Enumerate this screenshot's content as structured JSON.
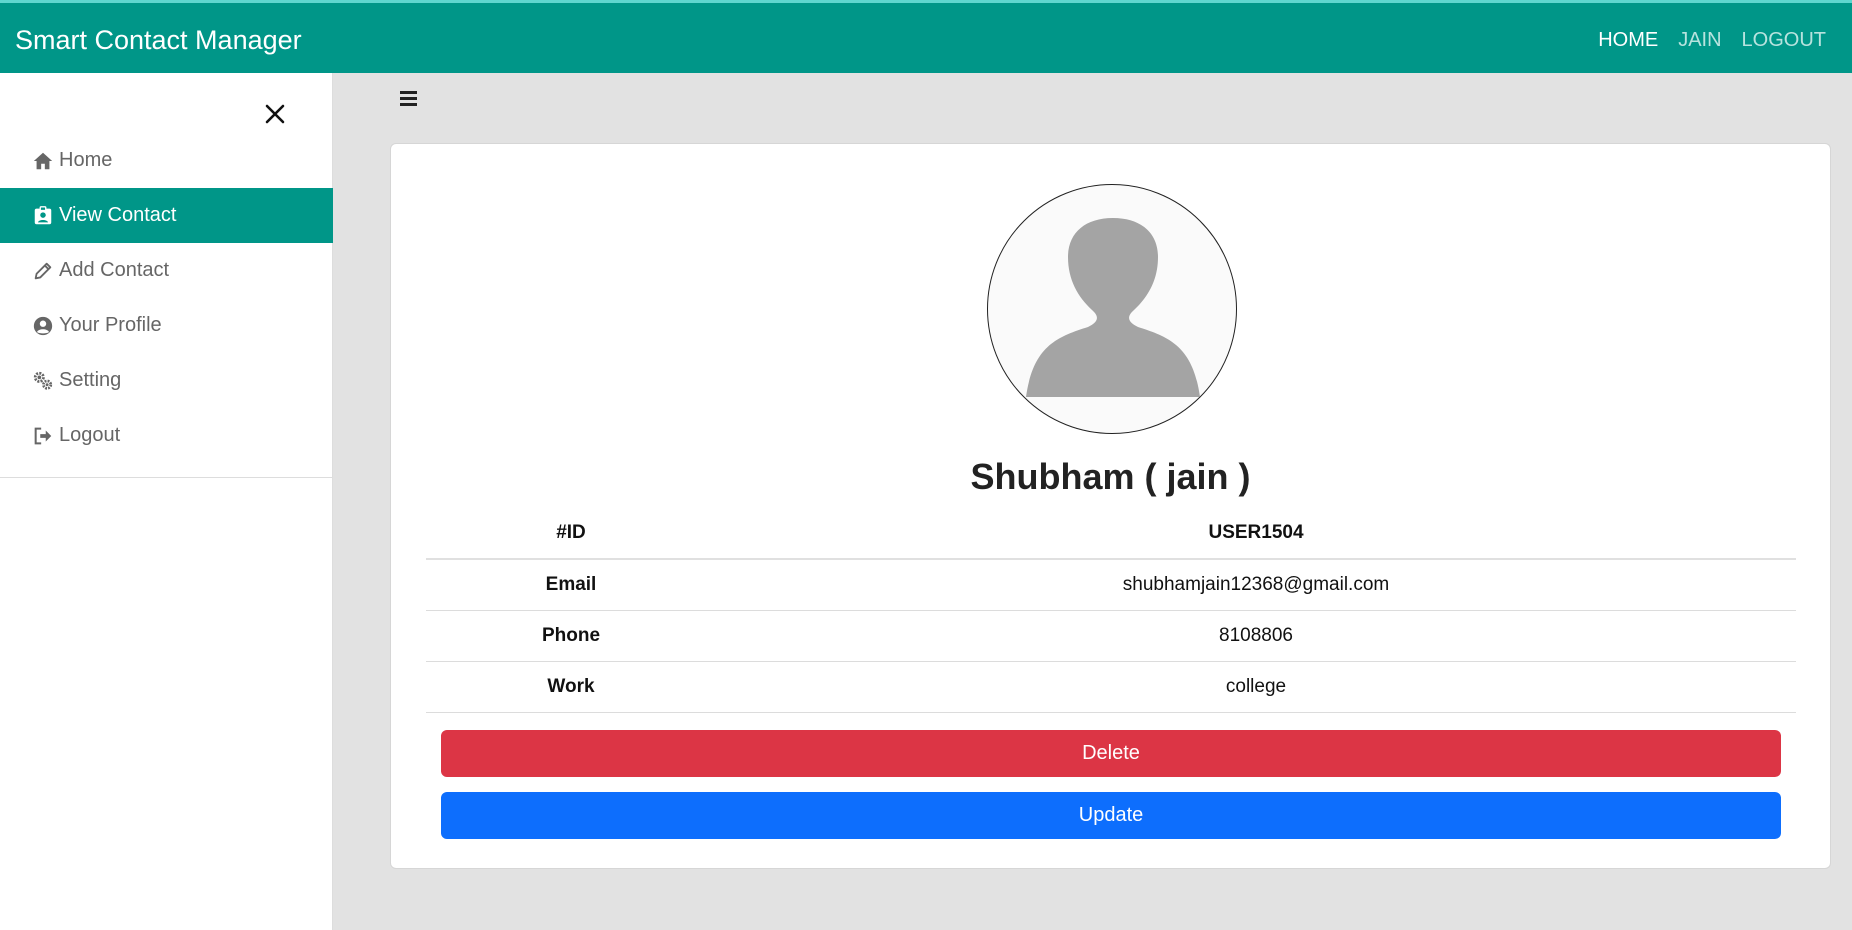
{
  "app": {
    "title": "Smart Contact Manager"
  },
  "topnav": {
    "home": "HOME",
    "user": "JAIN",
    "logout": "LOGOUT"
  },
  "sidebar": {
    "items": [
      {
        "label": "Home",
        "icon": "home-icon"
      },
      {
        "label": "View Contact",
        "icon": "id-badge-icon",
        "active": true
      },
      {
        "label": "Add Contact",
        "icon": "pencil-icon"
      },
      {
        "label": "Your Profile",
        "icon": "user-circle-icon"
      },
      {
        "label": "Setting",
        "icon": "gears-icon"
      },
      {
        "label": "Logout",
        "icon": "sign-out-icon"
      }
    ]
  },
  "contact": {
    "name": "Shubham ( jain )",
    "rows": [
      {
        "key": "#ID",
        "value": "USER1504"
      },
      {
        "key": "Email",
        "value": "shubhamjain12368@gmail.com"
      },
      {
        "key": "Phone",
        "value": "8108806"
      },
      {
        "key": "Work",
        "value": "college"
      }
    ]
  },
  "actions": {
    "delete": "Delete",
    "update": "Update"
  },
  "colors": {
    "primary": "#009688",
    "danger": "#dc3545",
    "blue": "#0d6efd"
  }
}
